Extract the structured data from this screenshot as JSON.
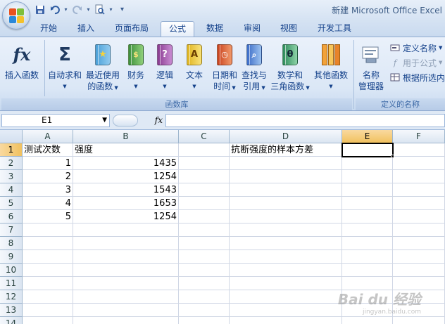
{
  "window": {
    "title": "新建 Microsoft Office Excel"
  },
  "colors": {
    "ribbon_text": "#15428b",
    "accent_selected": "#f1c15f"
  },
  "qat": {
    "icons": [
      "save-icon",
      "undo-icon",
      "redo-icon",
      "print-preview-icon",
      "customize-icon"
    ]
  },
  "tabs": [
    {
      "label": "开始"
    },
    {
      "label": "插入"
    },
    {
      "label": "页面布局"
    },
    {
      "label": "公式",
      "active": true
    },
    {
      "label": "数据"
    },
    {
      "label": "审阅"
    },
    {
      "label": "视图"
    },
    {
      "label": "开发工具"
    }
  ],
  "ribbon": {
    "groups": {
      "function_library": "函数库",
      "defined_names": "定义的名称"
    },
    "buttons": {
      "insert_function": "插入函数",
      "autosum": "自动求和",
      "recent_1": "最近使用",
      "recent_2": "的函数",
      "financial": "财务",
      "logical": "逻辑",
      "text": "文本",
      "datetime_1": "日期和",
      "datetime_2": "时间",
      "lookup_1": "查找与",
      "lookup_2": "引用",
      "math_1": "数学和",
      "math_2": "三角函数",
      "more": "其他函数",
      "name_mgr_1": "名称",
      "name_mgr_2": "管理器",
      "define_name": "定义名称",
      "use_in_formula": "用于公式",
      "create_from_selection": "根据所选内容"
    },
    "glyphs": {
      "fx": "fx",
      "sigma": "Σ",
      "text_book": "A",
      "math_book": "θ",
      "logic_book": "?"
    }
  },
  "formula_bar": {
    "name_box": "E1",
    "fx_label": "fx",
    "formula": ""
  },
  "sheet": {
    "columns": [
      "A",
      "B",
      "C",
      "D",
      "E",
      "F"
    ],
    "rows": [
      "1",
      "2",
      "3",
      "4",
      "5",
      "6",
      "7",
      "8",
      "9",
      "10",
      "11",
      "12",
      "13",
      "14"
    ],
    "cells": {
      "A1": "测试次数",
      "B1": "强度",
      "D1": "抗断强度的样本方差",
      "A2": "1",
      "B2": "1435",
      "A3": "2",
      "B3": "1254",
      "A4": "3",
      "B4": "1543",
      "A5": "4",
      "B5": "1653",
      "A6": "5",
      "B6": "1254"
    },
    "selected_cell": "E1"
  },
  "watermark": {
    "text": "Bai du 经验",
    "sub": "jingyan.baidu.com"
  }
}
